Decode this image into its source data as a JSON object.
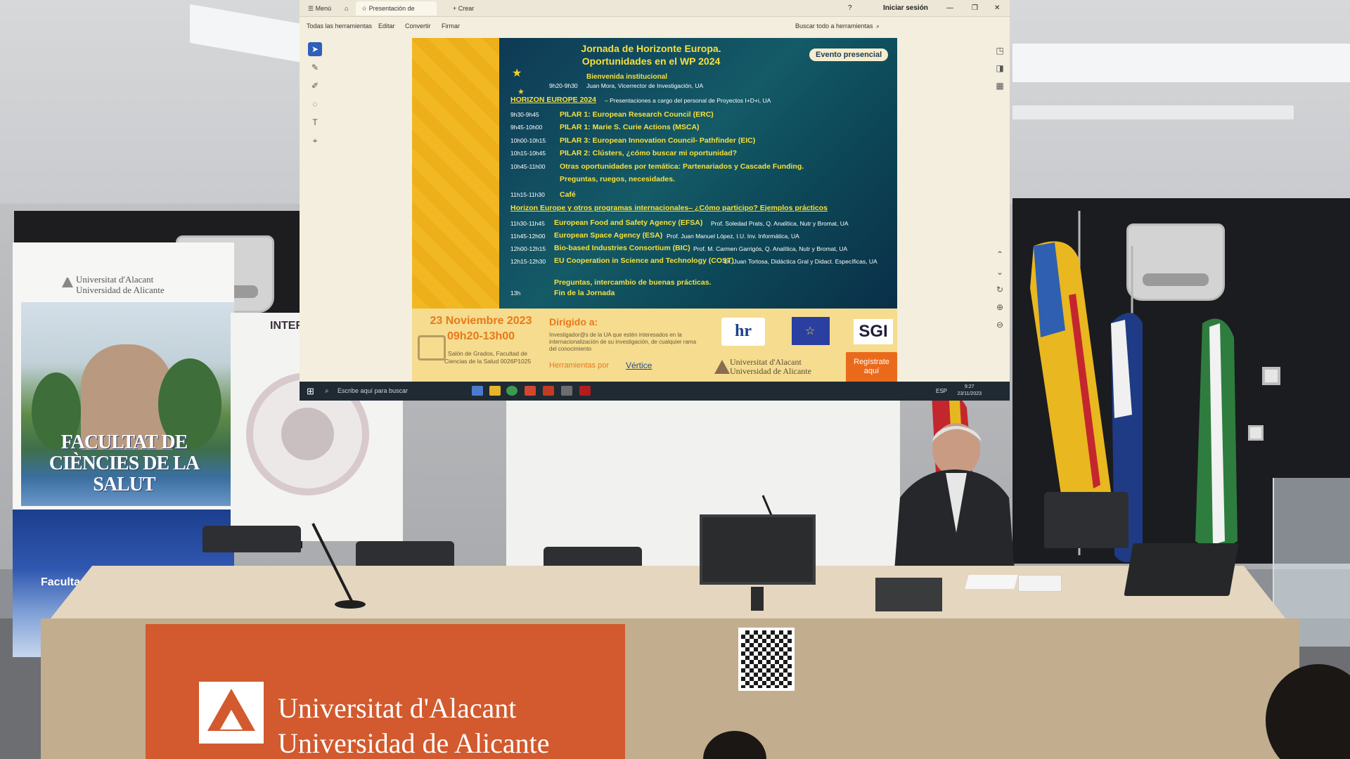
{
  "screen": {
    "tabs": [
      "Menú",
      "Presentación de Pow...",
      "Crear"
    ],
    "sign_in": "Iniciar sesión",
    "toolbar": [
      "Todas las herramientas",
      "Editar",
      "Convertir",
      "Firmar"
    ],
    "search_tools": "Buscar todo a herramientas",
    "taskbar_search": "Escribe aquí para buscar",
    "clock_time": "9:27",
    "clock_date": "23/11/2023",
    "keyboard_lang": "ESP"
  },
  "poster": {
    "headline_1": "Jornada de Horizonte Europa.",
    "headline_2": "Oportunidades en el WP 2024",
    "evento": "Evento presencial",
    "bienvenida": "Bienvenida institucional",
    "bienvenida_time": "9h20-9h30",
    "bienvenida_who": "Juan Mora, Vicerrector de Investigación, UA",
    "section1_title": "HORIZON EUROPE 2024",
    "section1_sub": "– Presentaciones a cargo del personal de Proyectos I+D+i, UA",
    "agenda1": [
      {
        "time": "9h30-9h45",
        "text": "PILAR 1: European Research Council (ERC)"
      },
      {
        "time": "9h45-10h00",
        "text": "PILAR 1: Marie S. Curie Actions (MSCA)"
      },
      {
        "time": "10h00-10h15",
        "text": "PILAR 3: European Innovation Council- Pathfinder (EIC)"
      },
      {
        "time": "10h15-10h45",
        "text": "PILAR 2: Clústers, ¿cómo buscar mi oportunidad?"
      },
      {
        "time": "10h45-11h00",
        "text": "Otras oportunidades por temática: Partenariados y Cascade Funding."
      },
      {
        "time": "",
        "text": "Preguntas, ruegos, necesidades."
      },
      {
        "time": "11h15-11h30",
        "text": "Café"
      }
    ],
    "section2_title": "Horizon Europe y otros programas internacionales– ¿Cómo participo? Ejemplos prácticos",
    "agenda2": [
      {
        "time": "11h30-11h45",
        "text": "European Food and Safety Agency (EFSA)",
        "who": "Prof. Soledad Prats, Q. Analítica, Nutr y Bromat, UA"
      },
      {
        "time": "11h45-12h00",
        "text": "European Space Agency (ESA)",
        "who": "Prof. Juan Manuel López, I.U. Inv. Informática, UA"
      },
      {
        "time": "12h00-12h15",
        "text": "Bio-based Industries Consortium (BIC)",
        "who": "Prof. M. Carmen Garrigós, Q. Analítica, Nutr y Bromat, UA"
      },
      {
        "time": "12h15-12h30",
        "text": "EU Cooperation in Science and Technology (COST)",
        "who": "Dr. Juan Tortosa, Didáctica Gral y Didact. Específicas, UA"
      }
    ],
    "closing_1": "Preguntas, intercambio de buenas prácticas.",
    "closing_time": "13h",
    "closing_2": "Fin de la Jornada",
    "date": "23 Noviembre 2023",
    "hours": "09h20-13h00",
    "place": "Salón de Grados, Facultad de Ciencias de la Salud 0026P1025",
    "dirigido": "Dirigido a:",
    "dirigido_text": "Investigador@s de la UA que estén interesados en la internacionalización de su investigación, de cualquier rama del conocimiento",
    "herramientas": "Herramientas por",
    "vertice": "Vértice",
    "logo_hr": "hr",
    "logo_sgi": "SGI",
    "ua_1": "Universitat d'Alacant",
    "ua_2": "Universidad de Alicante",
    "registrate": "Regístrate aquí"
  },
  "room": {
    "banner_left_uni_1": "Universitat d'Alacant",
    "banner_left_uni_2": "Universidad de Alicante",
    "banner_left_faculty_1": "FACULTAT DE",
    "banner_left_faculty_2": "CIÈNCIES DE LA SALUT",
    "banner_left_small": "Facultad",
    "banner_mid_title": "INTER",
    "sign_line_1": "Universitat d'Alacant",
    "sign_line_2": "Universidad de Alicante"
  }
}
